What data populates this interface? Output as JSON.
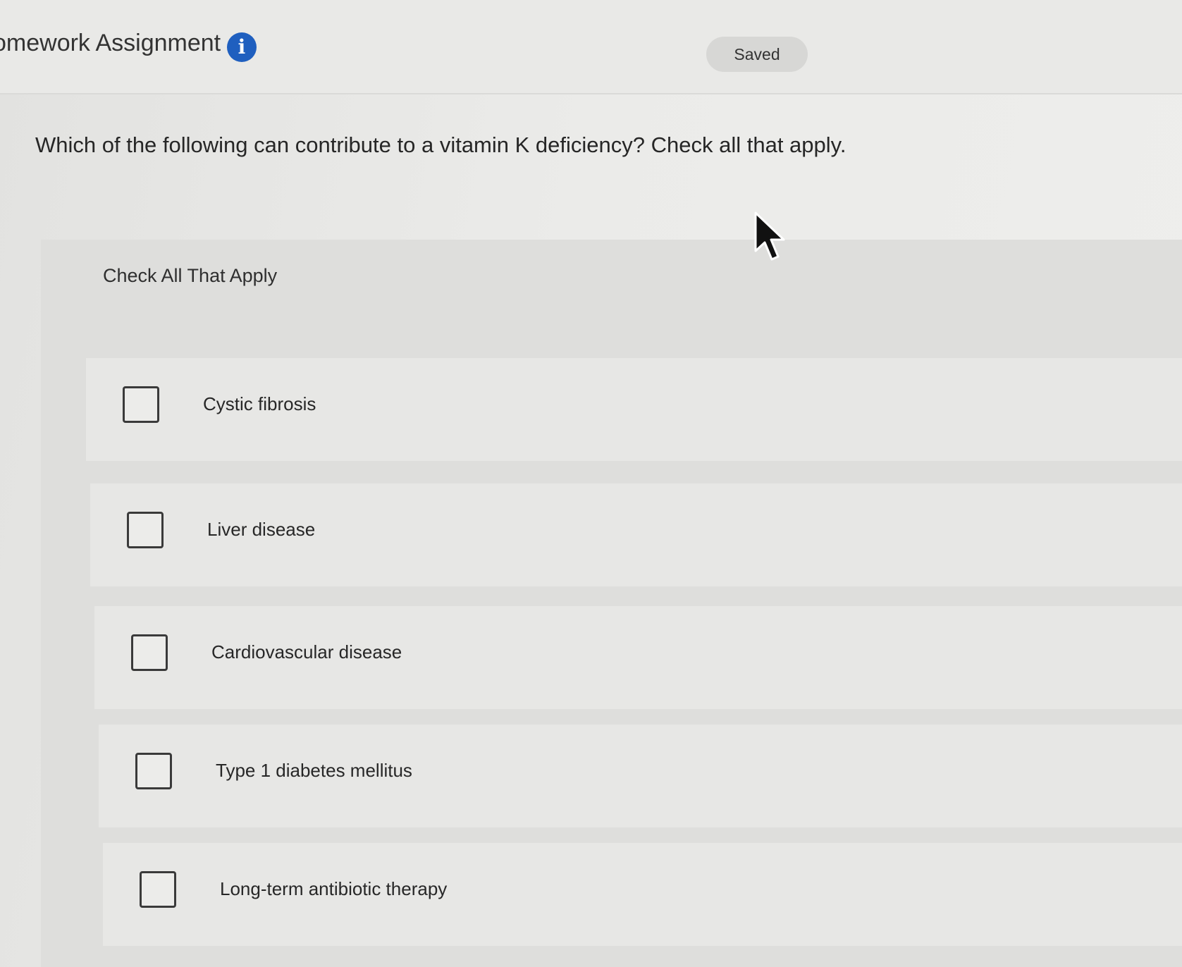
{
  "header": {
    "title": "omework Assignment",
    "saved_status": "Saved"
  },
  "question": {
    "text": "Which of the following can contribute to a vitamin K deficiency? Check all that apply."
  },
  "answer_panel": {
    "label": "Check All That Apply",
    "options": [
      {
        "label": "Cystic fibrosis",
        "checked": false
      },
      {
        "label": "Liver disease",
        "checked": false
      },
      {
        "label": "Cardiovascular disease",
        "checked": false
      },
      {
        "label": "Type 1 diabetes mellitus",
        "checked": false
      },
      {
        "label": "Long-term antibiotic therapy",
        "checked": false
      }
    ]
  },
  "colors": {
    "info_icon": "#1f5fbf",
    "page_background": "#e6e6e4"
  }
}
